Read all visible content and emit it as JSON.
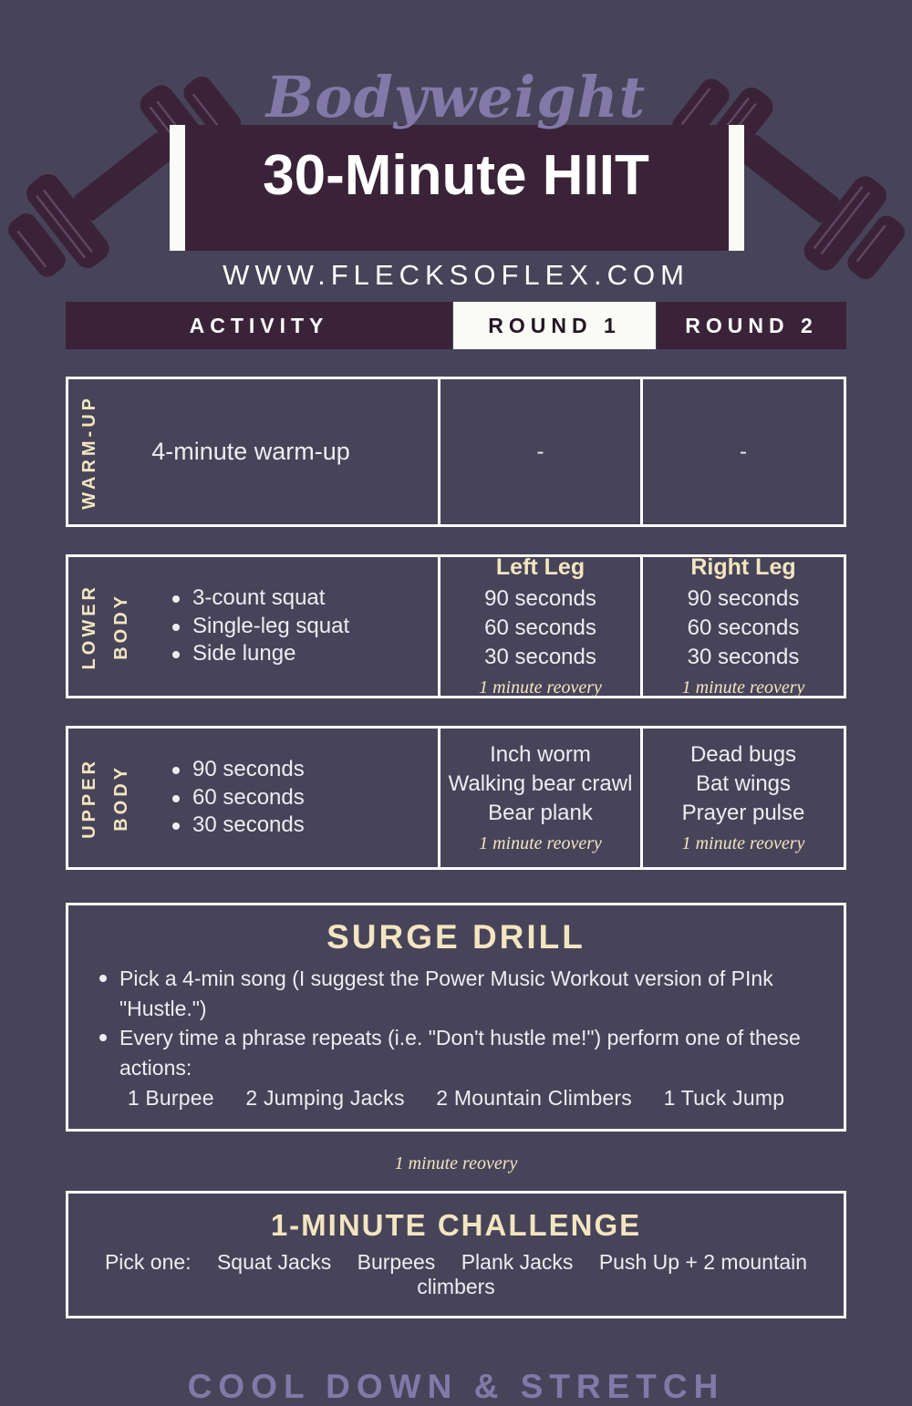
{
  "header": {
    "script_title": "Bodyweight",
    "main_title": "30-Minute HIIT",
    "website": "WWW.FLECKSOFLEX.COM"
  },
  "columns": {
    "activity": "ACTIVITY",
    "round1": "ROUND  1",
    "round2": "ROUND 2"
  },
  "warmup": {
    "tag": "WARM-UP",
    "activity": "4-minute warm-up",
    "round1": "-",
    "round2": "-"
  },
  "lower_body": {
    "tag_line1": "LOWER",
    "tag_line2": "BODY",
    "activities": [
      "3-count squat",
      "Single-leg squat",
      "Side lunge"
    ],
    "round1": {
      "heading": "Left Leg",
      "lines": [
        "90 seconds",
        "60 seconds",
        "30 seconds"
      ],
      "recovery": "1 minute reovery"
    },
    "round2": {
      "heading": "Right Leg",
      "lines": [
        "90 seconds",
        "60 seconds",
        "30 seconds"
      ],
      "recovery": "1 minute reovery"
    }
  },
  "upper_body": {
    "tag_line1": "UPPER",
    "tag_line2": "BODY",
    "activities": [
      "90 seconds",
      "60 seconds",
      "30 seconds"
    ],
    "round1": {
      "lines": [
        "Inch worm",
        "Walking bear crawl",
        "Bear plank"
      ],
      "recovery": "1 minute reovery"
    },
    "round2": {
      "lines": [
        "Dead bugs",
        "Bat wings",
        "Prayer pulse"
      ],
      "recovery": "1 minute reovery"
    }
  },
  "surge_drill": {
    "title": "SURGE DRILL",
    "bullets": [
      "Pick a 4-min song (I suggest the Power Music Workout version of PInk \"Hustle.\")",
      "Every time a phrase repeats (i.e. \"Don't hustle me!\") perform one of these actions:"
    ],
    "actions": [
      "1 Burpee",
      "2 Jumping Jacks",
      "2 Mountain Climbers",
      "1 Tuck Jump"
    ]
  },
  "mid_recovery": "1 minute reovery",
  "challenge": {
    "title": "1-MINUTE CHALLENGE",
    "prompt": "Pick one:",
    "options": [
      "Squat Jacks",
      "Burpees",
      "Plank Jacks",
      "Push Up + 2 mountain climbers"
    ]
  },
  "footer": "COOL DOWN & STRETCH",
  "colors": {
    "background": "#474459",
    "plum": "#3A2338",
    "cream": "#F2E5C0",
    "white": "#FAFAF7",
    "periwinkle": "#8279A8",
    "body_text": "#EDEDF2"
  }
}
